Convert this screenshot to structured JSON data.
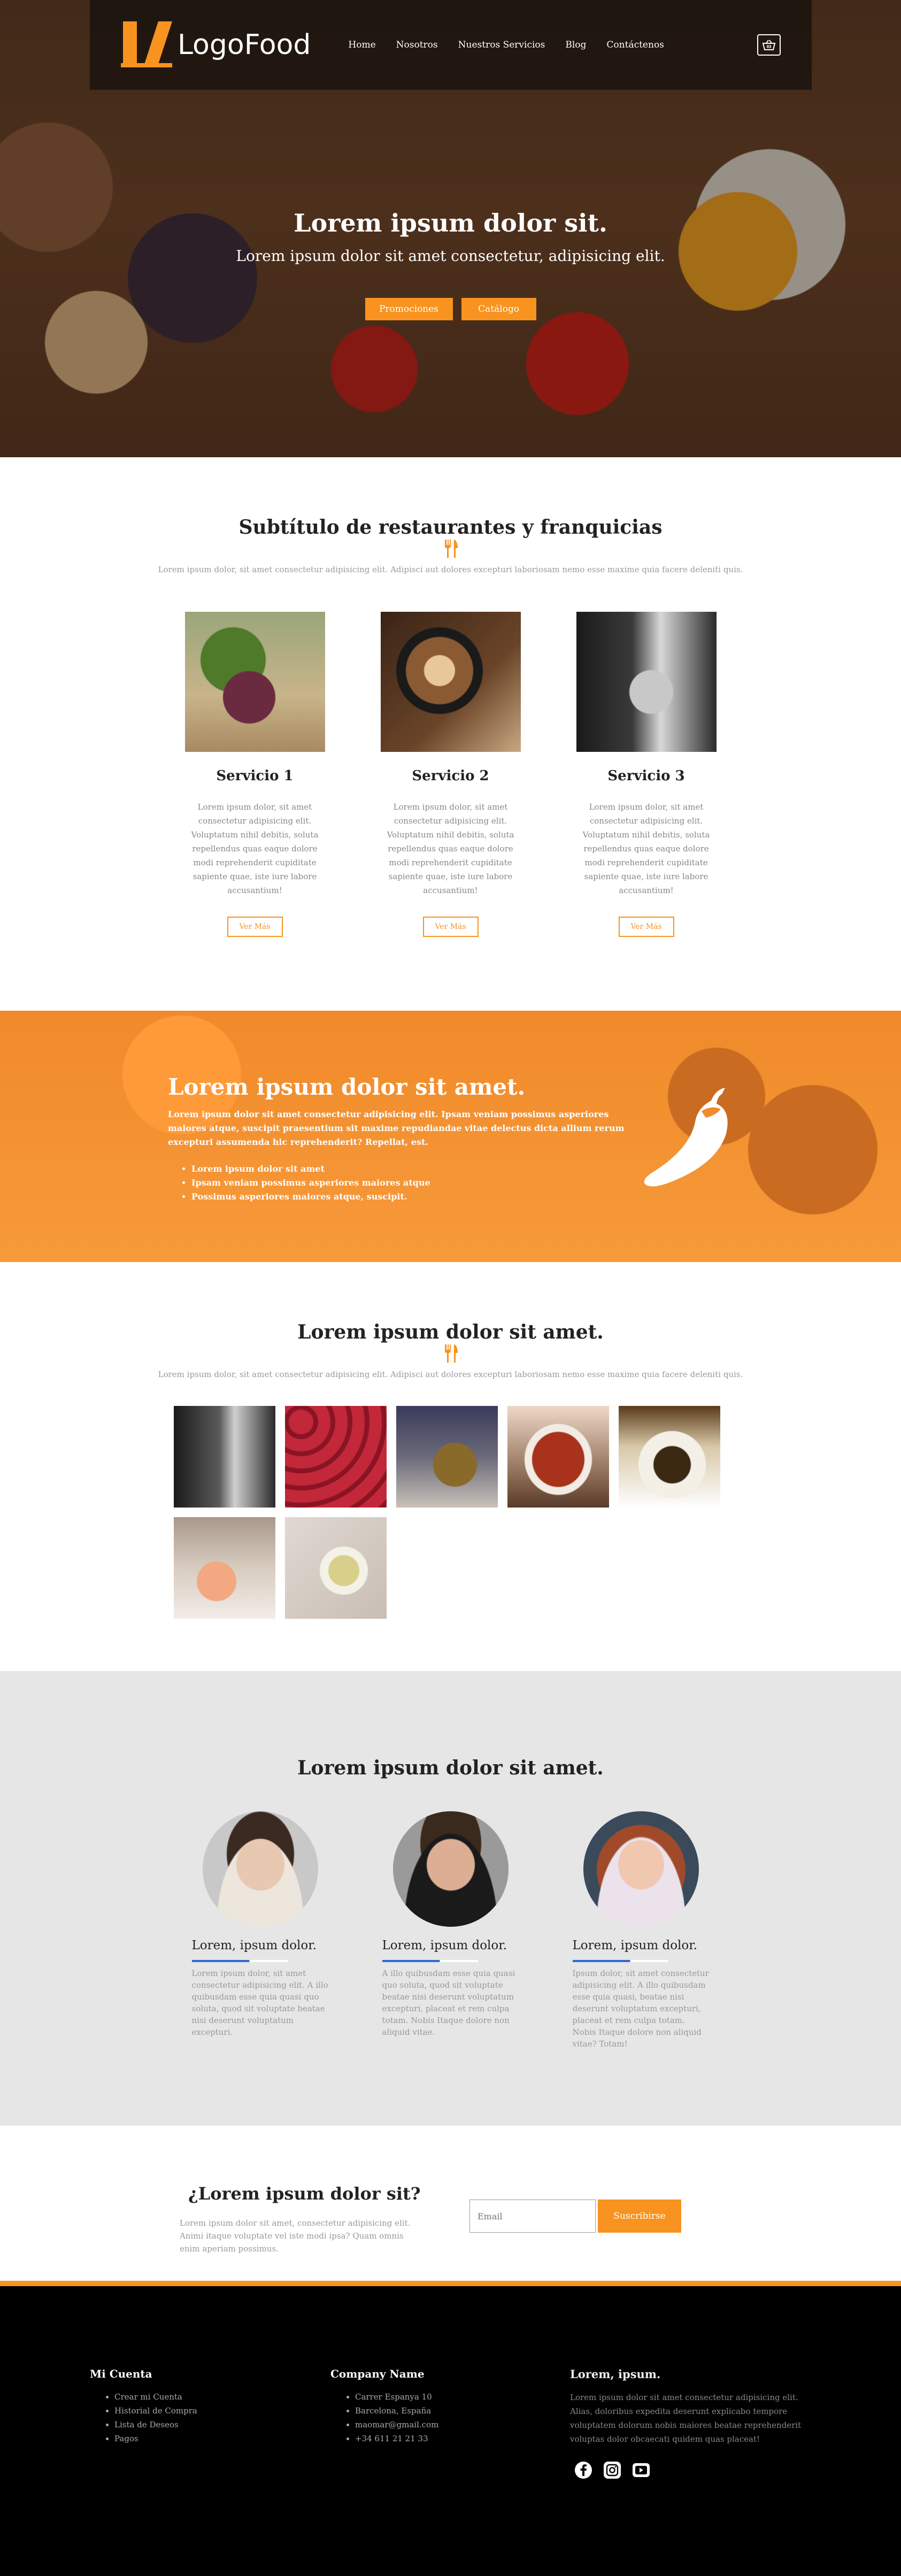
{
  "header": {
    "logo_text": "LogoFood",
    "nav": [
      "Home",
      "Nosotros",
      "Nuestros Servicios",
      "Blog",
      "Contáctenos"
    ]
  },
  "hero": {
    "title": "Lorem ipsum dolor sit.",
    "subtitle": "Lorem ipsum dolor sit amet consectetur, adipisicing elit.",
    "btn_promo": "Promociones",
    "btn_catalog": "Catálogo"
  },
  "services": {
    "title": "Subtítulo de restaurantes y franquicias",
    "desc": "Lorem ipsum dolor, sit amet consectetur adipisicing elit. Adipisci aut dolores excepturi laboriosam nemo esse maxime quia facere deleniti quis.",
    "items": [
      {
        "title": "Servicio 1",
        "text": "Lorem ipsum dolor, sit amet consectetur adipisicing elit. Voluptatum nihil debitis, soluta repellendus quas eaque dolore modi reprehenderit cupiditate sapiente quae, iste iure labore accusantium!",
        "button": "Ver Más"
      },
      {
        "title": "Servicio 2",
        "text": "Lorem ipsum dolor, sit amet consectetur adipisicing elit. Voluptatum nihil debitis, soluta repellendus quas eaque dolore modi reprehenderit cupiditate sapiente quae, iste iure labore accusantium!",
        "button": "Ver Más"
      },
      {
        "title": "Servicio 3",
        "text": "Lorem ipsum dolor, sit amet consectetur adipisicing elit. Voluptatum nihil debitis, soluta repellendus quas eaque dolore modi reprehenderit cupiditate sapiente quae, iste iure labore accusantium!",
        "button": "Ver Más"
      }
    ]
  },
  "promo": {
    "title": "Lorem ipsum dolor sit amet.",
    "text": "Lorem ipsum dolor sit amet consectetur adipisicing elit. Ipsam veniam possimus asperiores maiores atque, suscipit praesentium sit maxime repudiandae vitae delectus dicta allium rerum excepturi assumenda hic reprehenderit? Repellat, est.",
    "list": [
      "Lorem ipsum dolor sit amet",
      "Ipsam veniam possimus asperiores maiores atque",
      "Possimus asperiores maiores atque, suscipit."
    ]
  },
  "gallery": {
    "title": "Lorem ipsum dolor sit amet.",
    "desc": "Lorem ipsum dolor, sit amet consectetur adipisicing elit. Adipisci aut dolores excepturi laboriosam nemo esse maxime quia facere deleniti quis."
  },
  "team": {
    "title": "Lorem ipsum dolor sit amet.",
    "members": [
      {
        "name": "Lorem, ipsum dolor.",
        "text": "Lorem ipsum dolor, sit amet consectetur adipisicing elit. A illo quibusdam esse quia quasi quo soluta, quod sit voluptate beatae nisi deserunt voluptatum excepturi."
      },
      {
        "name": "Lorem, ipsum dolor.",
        "text": "A illo quibusdam esse quia quasi quo soluta, quod sit voluptate beatae nisi deserunt voluptatum excepturi, placeat et rem culpa totam. Nobis Itaque dolore non aliquid vitae."
      },
      {
        "name": "Lorem, ipsum dolor.",
        "text": "Ipsum dolor, sit amet consectetur adipisicing elit. A illo quibusdam esse quia quasi, beatae nisi deserunt voluptatum excepturi, placeat et rem culpa totam. Nobis Itaque dolore non aliquid vitae? Totam!"
      }
    ]
  },
  "newsletter": {
    "title": "¿Lorem ipsum dolor sit?",
    "text": "Lorem ipsum dolor sit amet, consectetur adipisicing elit. Animi itaque voluptate vel iste modi ipsa? Quam omnis enim aperiam possimus.",
    "placeholder": "Email",
    "button": "Suscribirse"
  },
  "footer": {
    "col1": {
      "title": "Mi Cuenta",
      "items": [
        "Crear mi Cuenta",
        "Historial de Compra",
        "Lista de Deseos",
        "Pagos"
      ]
    },
    "col2": {
      "title": "Company Name",
      "items": [
        "Carrer Espanya 10",
        "Barcelona, España",
        "maomar@gmail.com",
        "+34 611 21 21 33"
      ]
    },
    "col3": {
      "title": "Lorem, ipsum.",
      "text": "Lorem ipsum dolor sit amet consectetur adipisicing elit. Alias, doloribus expedita deserunt explicabo tempore voluptatem dolorum nobis maiores beatae reprehenderit voluptas dolor obcaecati quidem quas placeat!"
    },
    "social": [
      "facebook-icon",
      "instagram-icon",
      "youtube-icon"
    ]
  },
  "colors": {
    "accent": "#f7931e",
    "dark": "#000000",
    "team_bg": "#e6e6e6",
    "bar_blue": "#2d6bd0"
  }
}
